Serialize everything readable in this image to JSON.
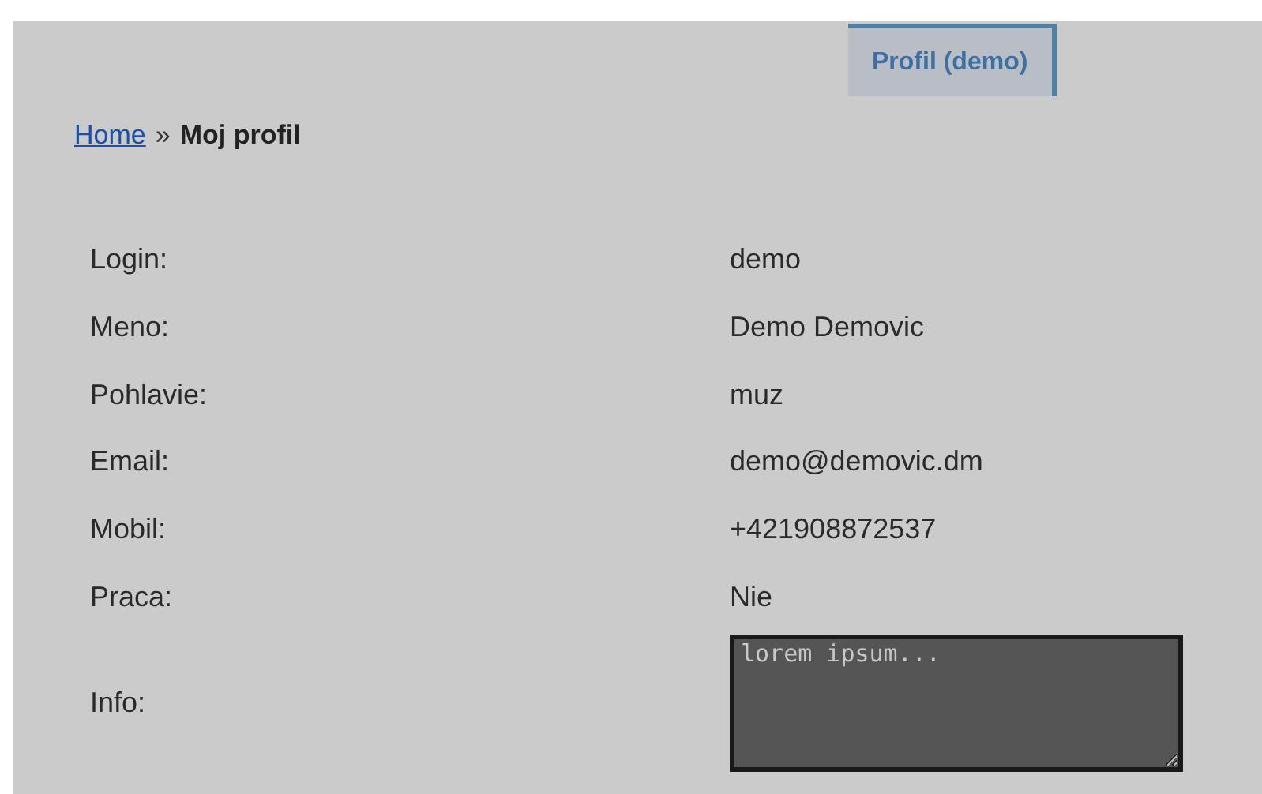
{
  "tabs": [
    {
      "label": "Profil (demo)",
      "selected": true
    }
  ],
  "breadcrumb": {
    "home": "Home",
    "separator": "»",
    "current": "Moj profil"
  },
  "fields": [
    {
      "label": "Login:",
      "value": "demo",
      "kind": "text"
    },
    {
      "label": "Meno:",
      "value": "Demo Demovic",
      "kind": "text"
    },
    {
      "label": "Pohlavie:",
      "value": "muz",
      "kind": "text"
    },
    {
      "label": "Email:",
      "value": "demo@demovic.dm",
      "kind": "text"
    },
    {
      "label": "Mobil:",
      "value": "+421908872537",
      "kind": "text"
    },
    {
      "label": "Praca:",
      "value": "Nie",
      "kind": "text"
    },
    {
      "label": "Info:",
      "value": "lorem ipsum...",
      "kind": "textarea"
    }
  ]
}
